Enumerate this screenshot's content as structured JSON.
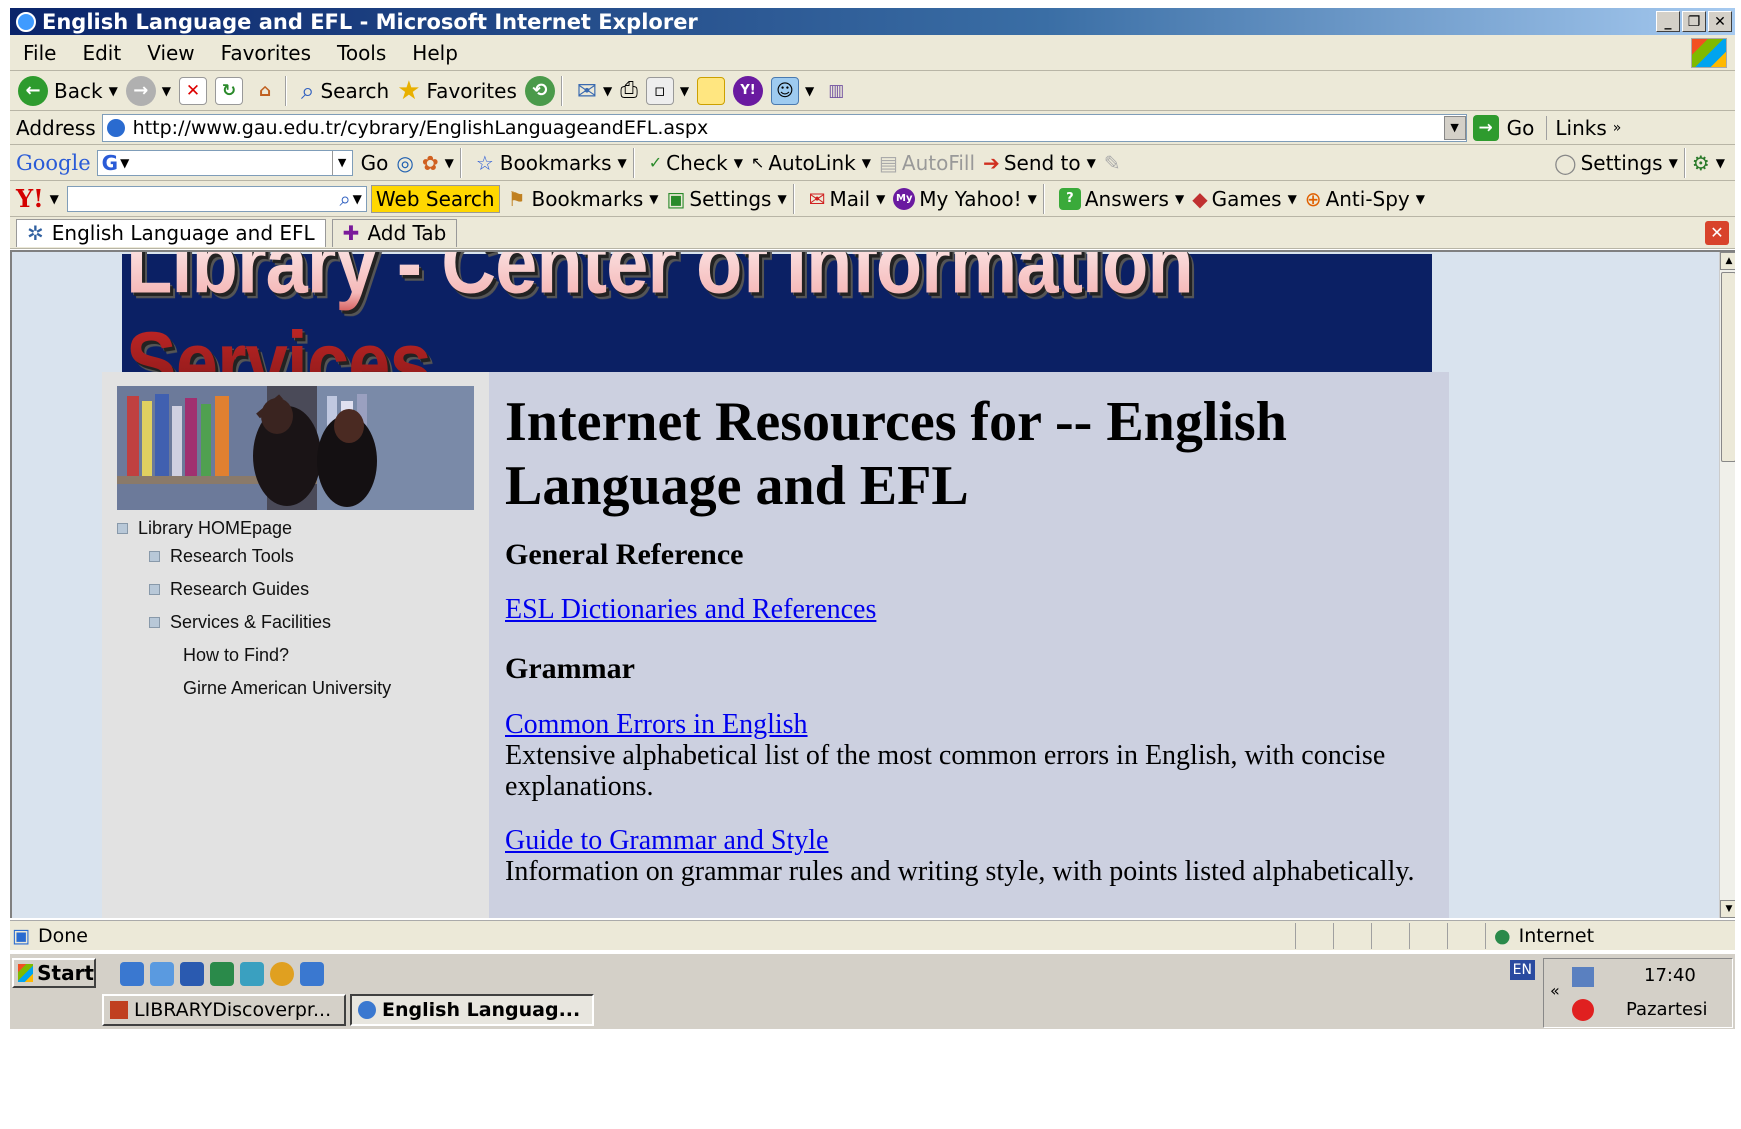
{
  "window": {
    "title": "English Language and EFL - Microsoft Internet Explorer"
  },
  "menubar": {
    "items": [
      "File",
      "Edit",
      "View",
      "Favorites",
      "Tools",
      "Help"
    ]
  },
  "toolbar": {
    "back": "Back",
    "search": "Search",
    "favorites": "Favorites"
  },
  "addressbar": {
    "label": "Address",
    "url": "http://www.gau.edu.tr/cybrary/EnglishLanguageandEFL.aspx",
    "go": "Go",
    "links": "Links"
  },
  "googlebar": {
    "logo": "Google",
    "go": "Go",
    "bookmarks": "Bookmarks",
    "check": "Check",
    "autolink": "AutoLink",
    "autofill": "AutoFill",
    "sendto": "Send to",
    "settings": "Settings"
  },
  "yahoobar": {
    "logo": "Y!",
    "web_search": "Web Search",
    "bookmarks": "Bookmarks",
    "settings": "Settings",
    "mail": "Mail",
    "my_yahoo": "My Yahoo!",
    "answers": "Answers",
    "games": "Games",
    "antispy": "Anti-Spy"
  },
  "tabs": {
    "active": "English Language and EFL",
    "add": "Add Tab"
  },
  "page": {
    "banner": "Library - Center of Information Services",
    "nav": {
      "home": "Library HOMEpage",
      "tools": "Research Tools",
      "guides": "Research Guides",
      "services": "Services & Facilities",
      "howto": "How to Find?",
      "gau": "Girne American University"
    },
    "heading": "Internet Resources for -- English Language and EFL",
    "sections": {
      "general": "General Reference",
      "general_link": "ESL Dictionaries and References",
      "grammar": "Grammar",
      "link1": "Common Errors in English",
      "desc1": "Extensive alphabetical list of the most common errors in English, with concise explanations.",
      "link2": "Guide to Grammar and Style",
      "desc2": "Information on grammar rules and writing style, with points listed alphabetically."
    }
  },
  "statusbar": {
    "status": "Done",
    "zone": "Internet"
  },
  "taskbar": {
    "start": "Start",
    "task1": "LIBRARYDiscoverpr...",
    "task2": "English Languag...",
    "time": "17:40",
    "day": "Pazartesi",
    "lang": "EN"
  },
  "colors": {
    "banner_bg": "#0b2064",
    "link": "#0000ee",
    "main_bg": "#ccd0e0",
    "sidebar_bg": "#e2e2e2"
  }
}
